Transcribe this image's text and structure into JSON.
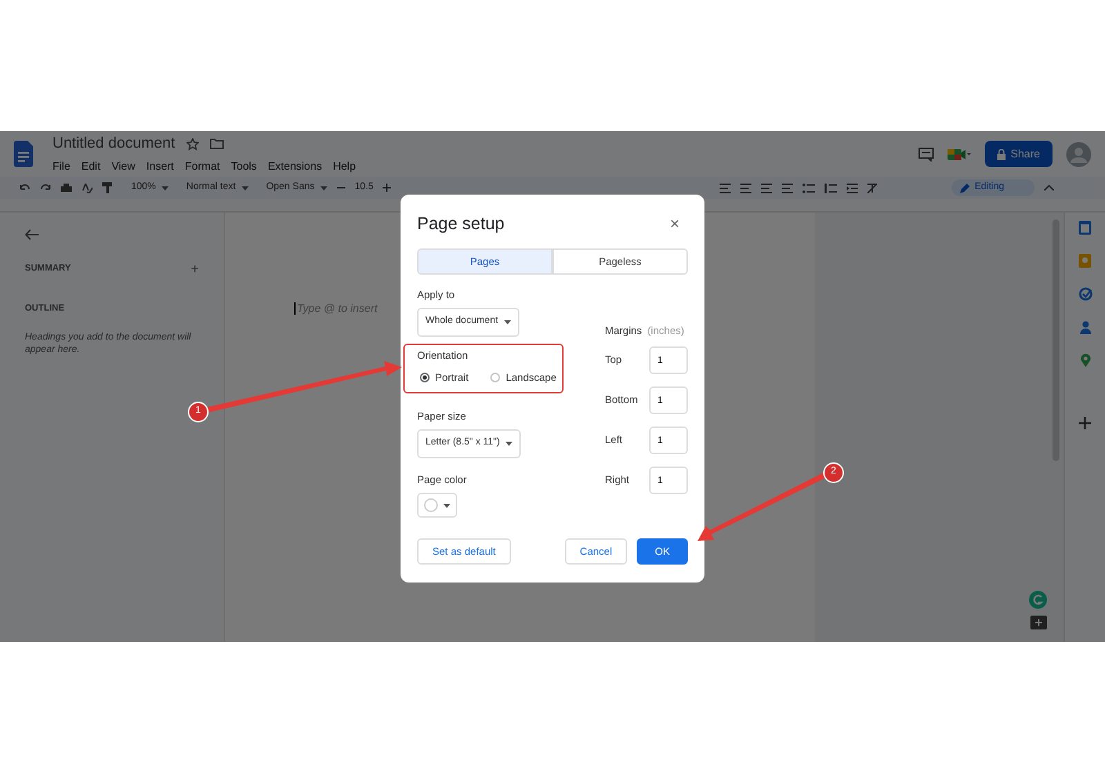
{
  "header": {
    "title": "Untitled document",
    "menus": [
      "File",
      "Edit",
      "View",
      "Insert",
      "Format",
      "Tools",
      "Extensions",
      "Help"
    ],
    "share": "Share"
  },
  "toolbar": {
    "zoom": "100%",
    "style": "Normal text",
    "font": "Open Sans",
    "size": "10.5",
    "mode": "Editing"
  },
  "sidebar": {
    "summary": "SUMMARY",
    "add": "+",
    "outline": "OUTLINE",
    "hint": "Headings you add to the document will appear here."
  },
  "document": {
    "placeholder": "Type @ to insert"
  },
  "dialog": {
    "title": "Page setup",
    "close": "×",
    "tabs": [
      {
        "label": "Pages",
        "selected": true
      },
      {
        "label": "Pageless",
        "selected": false
      }
    ],
    "apply_to": {
      "label": "Apply to",
      "value": "Whole document"
    },
    "orientation": {
      "label": "Orientation",
      "options": [
        {
          "label": "Portrait",
          "selected": true
        },
        {
          "label": "Landscape",
          "selected": false
        }
      ]
    },
    "paper_size": {
      "label": "Paper size",
      "value": "Letter (8.5\" x 11\")"
    },
    "page_color": {
      "label": "Page color"
    },
    "margins": {
      "label": "Margins",
      "unit": "(inches)",
      "fields": [
        {
          "label": "Top",
          "value": "1"
        },
        {
          "label": "Bottom",
          "value": "1"
        },
        {
          "label": "Left",
          "value": "1"
        },
        {
          "label": "Right",
          "value": "1"
        }
      ]
    },
    "buttons": [
      {
        "label": "Set as default",
        "kind": "secondary"
      },
      {
        "label": "Cancel",
        "kind": "secondary"
      },
      {
        "label": "OK",
        "kind": "primary"
      }
    ]
  },
  "annotations": [
    {
      "label": "1"
    },
    {
      "label": "2"
    }
  ]
}
